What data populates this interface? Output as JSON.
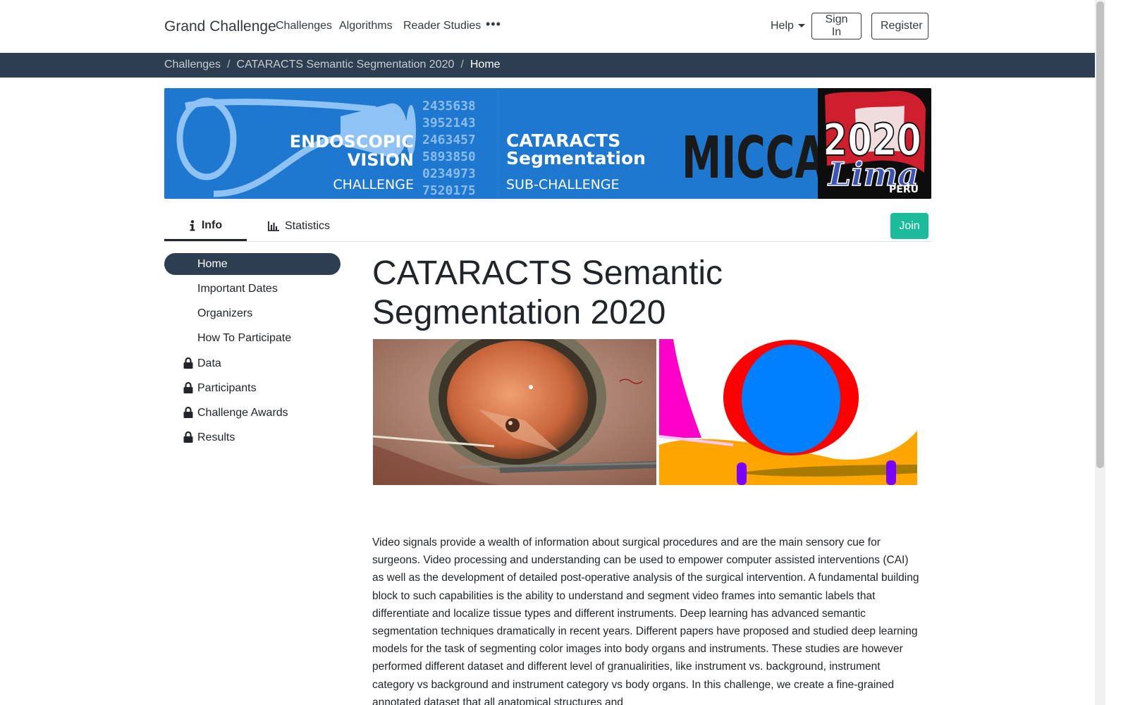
{
  "navbar": {
    "brand": "Grand Challenge",
    "links": [
      "Challenges",
      "Algorithms",
      "Reader Studies"
    ],
    "more": "•••",
    "help": "Help",
    "sign_in": "Sign In",
    "register": "Register"
  },
  "breadcrumb": {
    "items": [
      "Challenges",
      "CATARACTS Semantic Segmentation 2020"
    ],
    "current": "Home"
  },
  "banner": {
    "left_line1": "ENDOSCOPIC",
    "left_line2": "VISION",
    "left_line3": "CHALLENGE",
    "numbers": [
      "2435638",
      "3952143",
      "2463457",
      "5893850",
      "0234973",
      "7520175"
    ],
    "mid_line1": "CATARACTS",
    "mid_line2": "Segmentation",
    "mid_line3": "SUB-CHALLENGE",
    "miccai": "MICCAI",
    "year": "2020",
    "city": "Lima",
    "country": "PERU",
    "colors": {
      "banner_blue": "#1e78cf",
      "dark_blue": "#175fae"
    }
  },
  "tabs": {
    "info": "Info",
    "statistics": "Statistics"
  },
  "join": "Join",
  "sidebar": {
    "items": [
      {
        "label": "Home",
        "locked": false,
        "active": true
      },
      {
        "label": "Important Dates",
        "locked": false
      },
      {
        "label": "Organizers",
        "locked": false
      },
      {
        "label": "How To Participate",
        "locked": false
      },
      {
        "label": "Data",
        "locked": true
      },
      {
        "label": "Participants",
        "locked": true
      },
      {
        "label": "Challenge Awards",
        "locked": true
      },
      {
        "label": "Results",
        "locked": true
      }
    ]
  },
  "main": {
    "title": "CATARACTS Semantic Segmentation 2020",
    "paragraph": "Video signals provide a wealth of information about surgical procedures and are the main sensory cue for surgeons. Video processing and understanding can be used to empower computer assisted interventions (CAI) as well as the development of detailed post-operative analysis of the surgical intervention. A fundamental building block to such capabilities is the ability to understand and segment video frames into semantic labels that differentiate and localize tissue types and different instruments. Deep learning has advanced semantic segmentation techniques dramatically in recent years. Different papers have proposed and studied deep learning models for the task of segmenting color images into body organs and instruments. These studies are however performed different dataset and different level of granualirities, like instrument vs. background, instrument category vs background and instrument category vs body organs. In this challenge, we create a fine-grained annotated dataset that all anatomical structures and"
  },
  "colors": {
    "nav_dark": "#2d3e50",
    "join_green": "#1abc9c",
    "text": "#212529"
  }
}
